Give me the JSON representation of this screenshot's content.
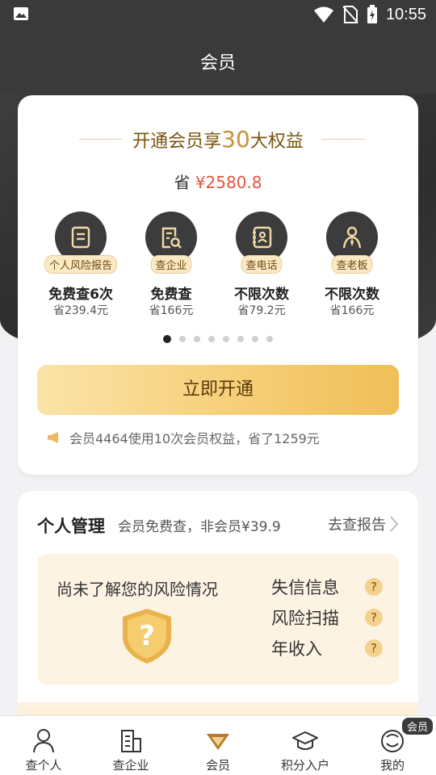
{
  "status_bar": {
    "time": "10:55"
  },
  "header": {
    "title": "会员"
  },
  "promo": {
    "headline_prefix": "开通会员享",
    "headline_number": "30",
    "headline_suffix": "大权益",
    "save_prefix": "省 ",
    "save_amount": "¥2580.8"
  },
  "benefits": [
    {
      "tag": "个人风险报告",
      "title": "免费查6次",
      "saving": "省239.4元",
      "icon": "report-icon"
    },
    {
      "tag": "查企业",
      "title": "免费查",
      "saving": "省166元",
      "icon": "company-search-icon"
    },
    {
      "tag": "查电话",
      "title": "不限次数",
      "saving": "省79.2元",
      "icon": "phonebook-icon"
    },
    {
      "tag": "查老板",
      "title": "不限次数",
      "saving": "省166元",
      "icon": "boss-icon"
    }
  ],
  "carousel": {
    "page_count": 8,
    "active_index": 0
  },
  "cta": {
    "label": "立即开通"
  },
  "usage_notice": "会员4464使用10次会员权益，省了1259元",
  "personal": {
    "title": "个人管理",
    "desc": "会员免费查，非会员¥39.9",
    "link": "去查报告",
    "risk_title": "尚未了解您的风险情况",
    "risk_items": [
      "失信信息",
      "风险扫描",
      "年收入"
    ],
    "q_mark": "?"
  },
  "bottom_nav": [
    {
      "label": "查个人",
      "icon": "person-icon"
    },
    {
      "label": "查企业",
      "icon": "building-icon"
    },
    {
      "label": "会员",
      "icon": "diamond-icon"
    },
    {
      "label": "积分入户",
      "icon": "graduation-cap-icon"
    },
    {
      "label": "我的",
      "icon": "smiley-icon",
      "badge": "会员"
    }
  ],
  "colors": {
    "gold": "#c8913a",
    "dark": "#3a3a3a",
    "price_red": "#e4553e"
  }
}
